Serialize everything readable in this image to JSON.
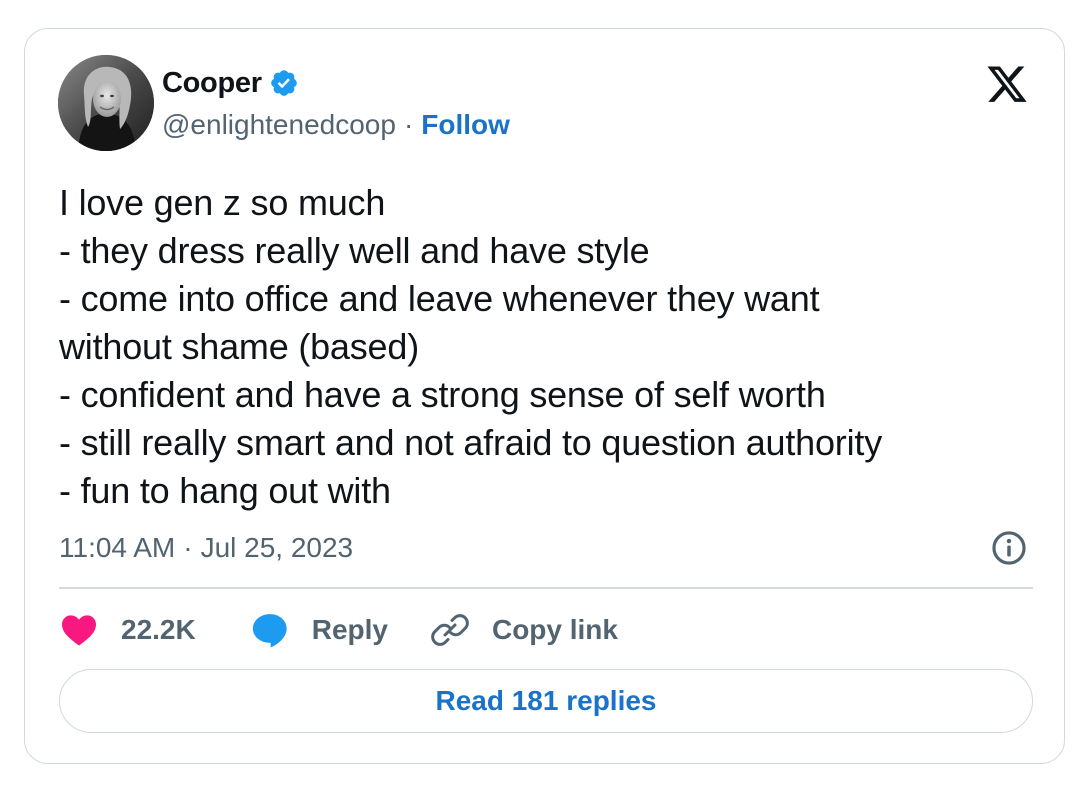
{
  "author": {
    "name": "Cooper",
    "handle": "@enlightenedcoop",
    "separator": "·",
    "follow_label": "Follow",
    "verified_color": "#1d9bf0"
  },
  "platform_icon": "x-logo-icon",
  "tweet": {
    "lines": [
      "I love gen z so much",
      "- they dress really well and have style",
      "- come into office and leave whenever they want",
      "without shame (based)",
      "- confident and have a strong sense of self worth",
      "- still really smart and not afraid to question authority",
      "- fun to hang out with"
    ]
  },
  "meta": {
    "time": "11:04 AM",
    "separator": "·",
    "date": "Jul 25, 2023"
  },
  "actions": {
    "like_count": "22.2K",
    "reply_label": "Reply",
    "copy_link_label": "Copy link",
    "like_color": "#f91880",
    "reply_color": "#1d9bf0"
  },
  "read_replies_label": "Read 181 replies",
  "colors": {
    "link_blue": "#1a73c8",
    "secondary_text": "#536471",
    "border": "#cfd9de"
  }
}
